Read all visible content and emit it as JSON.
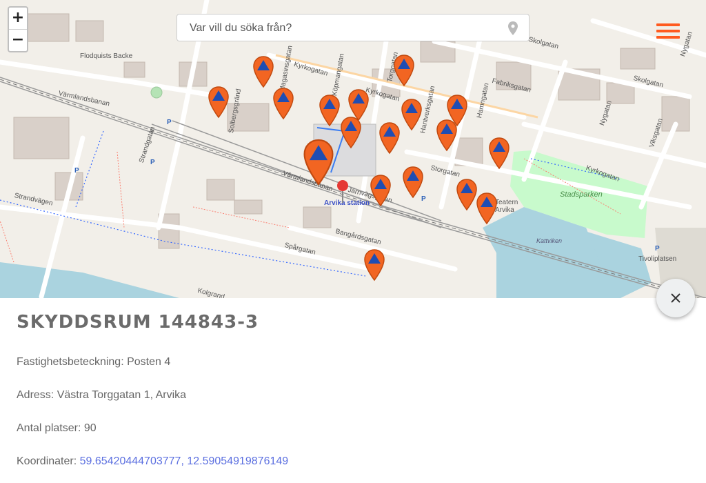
{
  "map": {
    "zoom_in_label": "+",
    "zoom_out_label": "−",
    "search": {
      "placeholder": "Var vill du söka från?"
    },
    "streets": [
      "Flodquists Backe",
      "Kyrkogatan",
      "Kyrkogatan",
      "Värmlandsbanan",
      "Solbergsgränd",
      "Magasinsgatan",
      "Köpmangatan",
      "Torggatan",
      "Fabriksgatan",
      "Skolgatan",
      "Skolgatan",
      "Nygatan",
      "Hantverksgatan",
      "Hamngatan",
      "Storgatan",
      "Strandgatan",
      "Strandvägen",
      "Järnvägsgatan",
      "Värmlandsbanan",
      "Bangårdsgatan",
      "Spårgatan",
      "Kolgrand",
      "Viksgatan",
      "Kyrkogatan",
      "Nygatan"
    ],
    "places": {
      "station": "Arvika station",
      "park": "Stadsparken",
      "lake": "Kattviken",
      "square": "Tivoliplatsen",
      "theater": "Teatern Arvika",
      "parking": "P"
    }
  },
  "menu_icon": "hamburger-icon",
  "detail": {
    "title": "SKYDDSRUM 144843-3",
    "property_label": "Fastighetsbeteckning:",
    "property_value": "Posten 4",
    "address_label": "Adress:",
    "address_value": "Västra Torggatan 1, Arvika",
    "capacity_label": "Antal platser:",
    "capacity_value": "90",
    "coords_label": "Koordinater:",
    "coords_value": "59.65420444703777, 12.59054919876149"
  },
  "colors": {
    "marker_fill": "#f26522",
    "marker_symbol": "#1f4db3",
    "accent": "#ff5a1f",
    "link": "#5b6fe0"
  }
}
